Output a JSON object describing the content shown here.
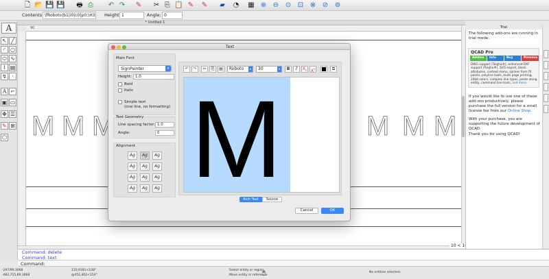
{
  "options_bar": {
    "contents_label": "Contents:",
    "contents_value": "\\fRoboto|b1|i0|c0|p0;\\H30;M",
    "height_label": "Height:",
    "height_value": "1",
    "angle_label": "Angle:",
    "angle_value": "0"
  },
  "drawing": {
    "tab_title": "* Untitled 1",
    "zoom_label": "10 < 100",
    "ruler_mark": "90"
  },
  "command": {
    "history": [
      "Command: delete",
      "Command: text"
    ],
    "label": "Command:"
  },
  "status": {
    "abs_coords": "-297/99.3068",
    "rel_coords": "-482,715,69.3068",
    "polar_abs": "110,9181<108°",
    "polar_rel": "@452,402<154°",
    "hint_1": "Select entity or region",
    "hint_2": "Move entity or reference",
    "selection": "No entities selected."
  },
  "right_panel": {
    "title": "Trial",
    "intro": "The following add-ons are running in trial mode:",
    "promo_title": "QCAD Pro",
    "promo_buttons": [
      "Addins",
      "Info",
      "Buy",
      "Remove"
    ],
    "promo_desc": "DWG support (Teigha®), enhanced DXF support (Teigha®), SVG export, block attributes, context menu, splines from fit points, polyline tools, multi page printing, 24bit colors, complex line types, paste along entity, command line tools,",
    "promo_link": "and more.",
    "para_1": "If you would like to use one of these add-ons productively, please purchase the full version for a small license fee from our",
    "shop_link": "Online Shop.",
    "para_2": "With your purchase, you are supporting the future development of QCAD.",
    "para_3": "Thank you for using QCAD!"
  },
  "dialog": {
    "title": "Text",
    "main_font_title": "Main Font",
    "font_name": "SignPainter",
    "height_label": "Height:",
    "height_value": "1,0",
    "bold_label": "Bold",
    "italic_label": "Italic",
    "simple_text_label": "Simple text",
    "simple_text_sub": "(one line, no formatting)",
    "geometry_title": "Text Geometry",
    "line_spacing_label": "Line spacing factor:",
    "line_spacing_value": "1,0",
    "angle_label": "Angle:",
    "angle_value": "0",
    "alignment_title": "Alignment",
    "align_glyph": "Ag",
    "editor_font": "Roboto",
    "editor_size": "30",
    "preview_text": "M",
    "tab_rich": "Rich Text",
    "tab_source": "Source",
    "cancel_label": "Cancel",
    "ok_label": "OK",
    "bold_btn": "B",
    "italic_btn": "I",
    "sub_btn": "X",
    "sup_btn": "X"
  },
  "colors": {
    "accent_blue": "#3b88f5",
    "selection_blue": "#b7dbfe",
    "command_text": "#2b3fd1",
    "promo_green": "#54b948",
    "promo_blue": "#2f7fd8",
    "promo_red": "#d94040"
  },
  "icons": {
    "top_toolbar": [
      "new-file-icon",
      "open-file-icon",
      "save-icon",
      "save-as-icon",
      "print-icon",
      "undo-icon",
      "redo-icon",
      "pen-icon",
      "cut-icon",
      "copy-icon",
      "paste-icon",
      "block-icon",
      "layer-icon",
      "flag-icon",
      "snap-icon",
      "grid-icon",
      "zoom-in-icon",
      "zoom-out-icon",
      "zoom-auto-icon",
      "zoom-window-icon",
      "pan-icon",
      "zoom-prev-icon"
    ],
    "left_tools": [
      "select-icon",
      "line-icon",
      "arc-icon",
      "circle-icon",
      "ellipse-icon",
      "spline-icon",
      "polyline-icon",
      "hatch-icon",
      "text-icon",
      "dimension-icon",
      "block-tool-icon",
      "image-icon",
      "modify-icon",
      "properties-icon",
      "move-icon",
      "3d-icon"
    ]
  }
}
